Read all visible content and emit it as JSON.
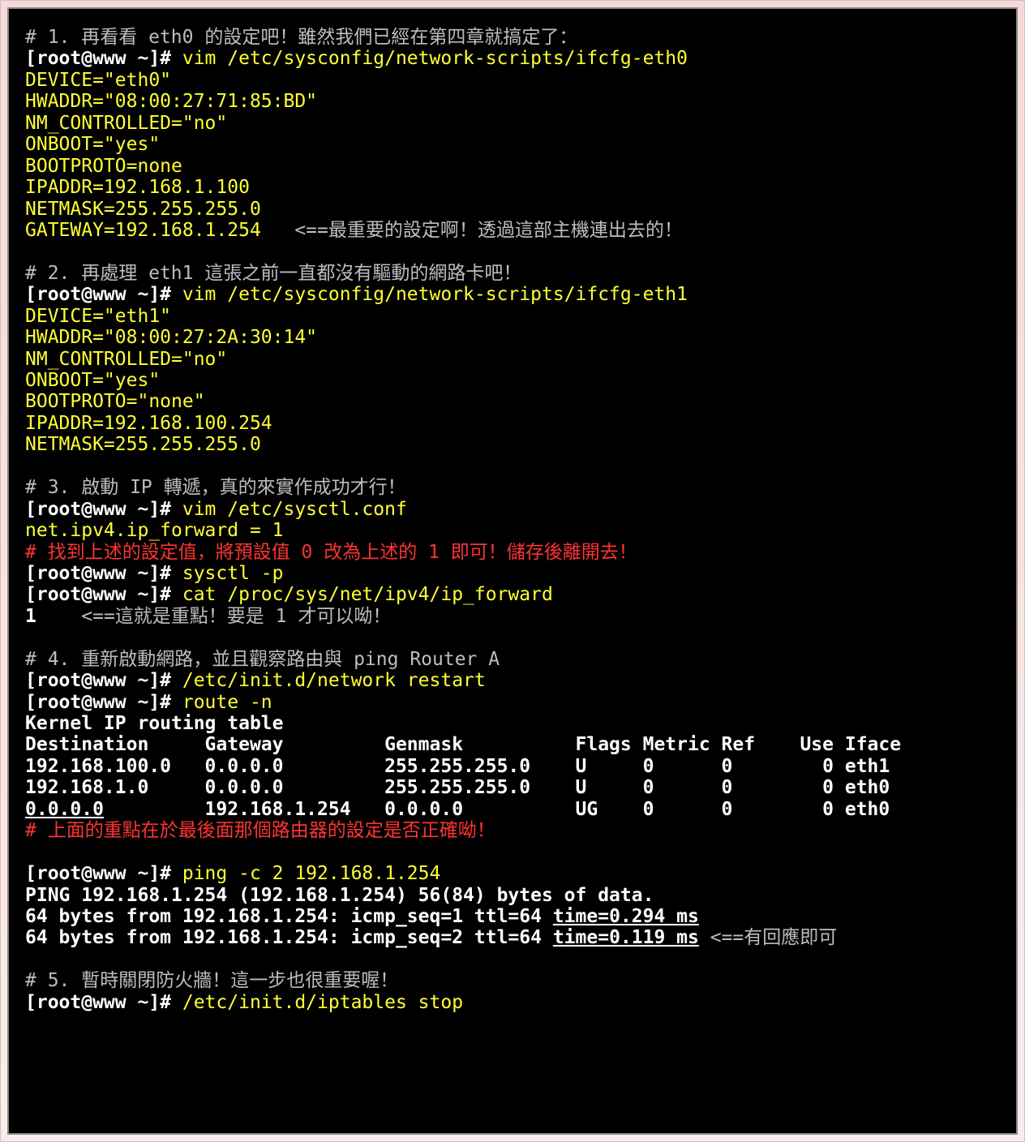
{
  "s1": {
    "comment": "# 1. 再看看 eth0 的設定吧！雖然我們已經在第四章就搞定了：",
    "prompt": "[root@www ~]#",
    "cmd": " vim /etc/sysconfig/network-scripts/ifcfg-eth0",
    "l1": "DEVICE=\"eth0\"",
    "l2": "HWADDR=\"08:00:27:71:85:BD\"",
    "l3": "NM_CONTROLLED=\"no\"",
    "l4": "ONBOOT=\"yes\"",
    "l5": "BOOTPROTO=none",
    "l6": "IPADDR=192.168.1.100",
    "l7": "NETMASK=255.255.255.0",
    "l8a": "GATEWAY=192.168.1.254",
    "l8b": "   <==最重要的設定啊！透過這部主機連出去的！"
  },
  "s2": {
    "comment": "# 2. 再處理 eth1 這張之前一直都沒有驅動的網路卡吧！",
    "prompt": "[root@www ~]#",
    "cmd": " vim /etc/sysconfig/network-scripts/ifcfg-eth1",
    "l1": "DEVICE=\"eth1\"",
    "l2": "HWADDR=\"08:00:27:2A:30:14\"",
    "l3": "NM_CONTROLLED=\"no\"",
    "l4": "ONBOOT=\"yes\"",
    "l5": "BOOTPROTO=\"none\"",
    "l6": "IPADDR=192.168.100.254",
    "l7": "NETMASK=255.255.255.0"
  },
  "s3": {
    "comment": "# 3. 啟動 IP 轉遞，真的來實作成功才行！",
    "prompt": "[root@www ~]#",
    "cmd1": " vim /etc/sysctl.conf",
    "line": "net.ipv4.ip_forward = 1",
    "red": "# 找到上述的設定值，將預設值 0 改為上述的 1 即可！儲存後離開去！",
    "cmd2": " sysctl -p",
    "cmd3": " cat /proc/sys/net/ipv4/ip_forward",
    "out_a": "1",
    "out_b": "    <==這就是重點！要是 1 才可以呦！"
  },
  "s4": {
    "comment": "# 4. 重新啟動網路，並且觀察路由與 ping Router A",
    "prompt": "[root@www ~]#",
    "cmd1": " /etc/init.d/network restart",
    "cmd2": " route -n",
    "rt_title": "Kernel IP routing table",
    "rt_hdr": "Destination     Gateway         Genmask          Flags Metric Ref    Use Iface",
    "rt_r1": "192.168.100.0   0.0.0.0         255.255.255.0    U     0      0        0 eth1",
    "rt_r2": "192.168.1.0     0.0.0.0         255.255.255.0    U     0      0        0 eth0",
    "rt_r3a": "0.0.0.0",
    "rt_r3b": "         192.168.1.254   0.0.0.0          UG    0      0        0 eth0",
    "red": "# 上面的重點在於最後面那個路由器的設定是否正確呦！",
    "ping_cmd": " ping -c 2 192.168.1.254",
    "ping_hdr": "PING 192.168.1.254 (192.168.1.254) 56(84) bytes of data.",
    "ping_l1a": "64 bytes from 192.168.1.254: icmp_seq=1 ttl=64 ",
    "ping_l1b": "time=0.294 ms",
    "ping_l2a": "64 bytes from 192.168.1.254: icmp_seq=2 ttl=64 ",
    "ping_l2b": "time=0.119 ms",
    "ping_l2c": " <==有回應即可"
  },
  "s5": {
    "comment": "# 5. 暫時關閉防火牆！這一步也很重要喔！",
    "prompt": "[root@www ~]#",
    "cmd": " /etc/init.d/iptables stop"
  }
}
